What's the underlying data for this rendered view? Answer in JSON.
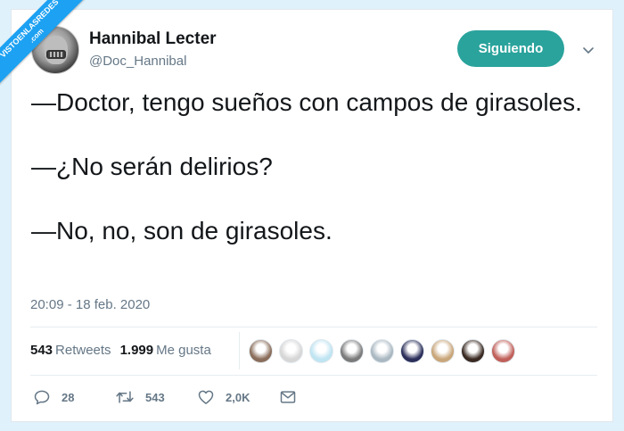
{
  "watermark": {
    "line1": "VISTOENLASREDES",
    "line2": ".com"
  },
  "tweet": {
    "author_name": "Hannibal Lecter",
    "author_handle": "@Doc_Hannibal",
    "follow_label": "Siguiendo",
    "lines": [
      "—Doctor, tengo sueños con campos de girasoles.",
      "—¿No serán delirios?",
      "—No, no, son de girasoles."
    ],
    "timestamp": "20:09 - 18 feb. 2020"
  },
  "stats": {
    "retweets_count": "543",
    "retweets_label": "Retweets",
    "likes_count": "1.999",
    "likes_label": "Me gusta"
  },
  "likers": [
    {
      "icon": "avatar",
      "color": "#8a6d5a"
    },
    {
      "icon": "avatar",
      "color": "#d6d6d6"
    },
    {
      "icon": "avatar",
      "color": "#bfe4f2"
    },
    {
      "icon": "avatar",
      "color": "#7b7b7b"
    },
    {
      "icon": "default-avatar",
      "color": "#aab8c2"
    },
    {
      "icon": "avatar",
      "color": "#2b2f5a"
    },
    {
      "icon": "avatar",
      "color": "#c9a67a"
    },
    {
      "icon": "avatar",
      "color": "#3a2a22"
    },
    {
      "icon": "avatar",
      "color": "#c0605a"
    }
  ],
  "actions": {
    "reply_count": "28",
    "retweet_count": "543",
    "like_count": "2,0K"
  },
  "colors": {
    "accent": "#2aa39c",
    "secondary_text": "#657786",
    "watermark": "#1da1f2"
  }
}
